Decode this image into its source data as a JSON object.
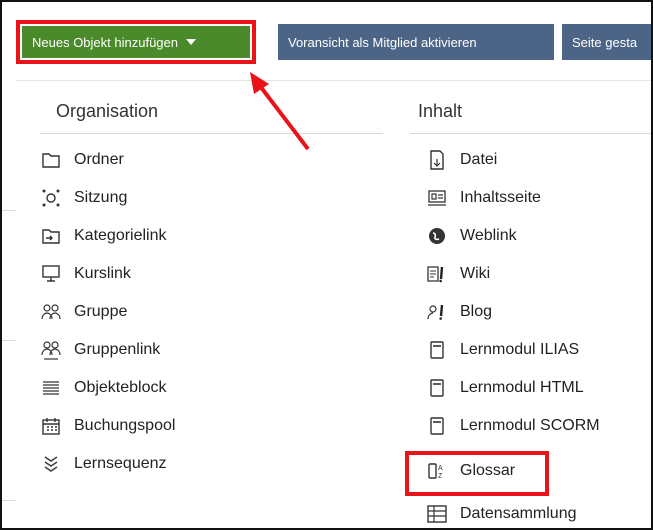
{
  "toolbar": {
    "new_object_label": "Neues Objekt hinzufügen",
    "preview_label": "Voransicht als Mitglied aktivieren",
    "page_label": "Seite gesta"
  },
  "menu": {
    "organisation": {
      "heading": "Organisation",
      "items": [
        {
          "label": "Ordner",
          "icon": "folder-icon"
        },
        {
          "label": "Sitzung",
          "icon": "session-icon"
        },
        {
          "label": "Kategorielink",
          "icon": "category-link-icon"
        },
        {
          "label": "Kurslink",
          "icon": "course-link-icon"
        },
        {
          "label": "Gruppe",
          "icon": "group-icon"
        },
        {
          "label": "Gruppenlink",
          "icon": "group-link-icon"
        },
        {
          "label": "Objekteblock",
          "icon": "object-block-icon"
        },
        {
          "label": "Buchungspool",
          "icon": "calendar-icon"
        },
        {
          "label": "Lernsequenz",
          "icon": "learning-sequence-icon"
        }
      ]
    },
    "inhalt": {
      "heading": "Inhalt",
      "items": [
        {
          "label": "Datei",
          "icon": "file-icon"
        },
        {
          "label": "Inhaltsseite",
          "icon": "content-page-icon"
        },
        {
          "label": "Weblink",
          "icon": "weblink-icon"
        },
        {
          "label": "Wiki",
          "icon": "wiki-icon"
        },
        {
          "label": "Blog",
          "icon": "blog-icon"
        },
        {
          "label": "Lernmodul ILIAS",
          "icon": "module-icon"
        },
        {
          "label": "Lernmodul HTML",
          "icon": "module-icon"
        },
        {
          "label": "Lernmodul SCORM",
          "icon": "module-icon"
        },
        {
          "label": "Glossar",
          "icon": "glossary-icon"
        },
        {
          "label": "Datensammlung",
          "icon": "data-collection-icon"
        }
      ]
    }
  },
  "colors": {
    "green_button": "#4b8a2a",
    "dark_button": "#4c6586",
    "highlight_red": "#e8141a"
  }
}
